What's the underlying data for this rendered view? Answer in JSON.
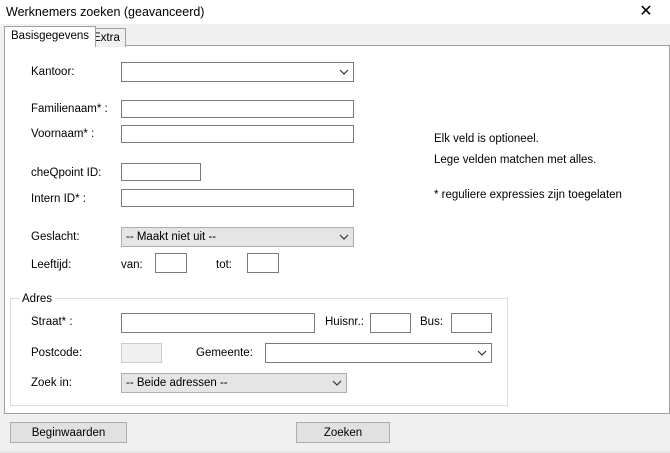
{
  "window": {
    "title": "Werknemers zoeken (geavanceerd)",
    "close_glyph": "✕"
  },
  "tabs": [
    {
      "label": "Basisgegevens",
      "active": true
    },
    {
      "label": "Extra",
      "active": false
    }
  ],
  "form": {
    "kantoor_label": "Kantoor:",
    "kantoor_value": "",
    "familienaam_label": "Familienaam* :",
    "familienaam_value": "",
    "voornaam_label": "Voornaam* :",
    "voornaam_value": "",
    "checkpoint_label": "cheQpoint ID:",
    "checkpoint_value": "",
    "intern_label": "Intern ID* :",
    "intern_value": "",
    "geslacht_label": "Geslacht:",
    "geslacht_value": "-- Maakt niet uit --",
    "leeftijd_label": "Leeftijd:",
    "van_label": "van:",
    "van_value": "",
    "tot_label": "tot:",
    "tot_value": ""
  },
  "notes": {
    "line1": "Elk veld is optioneel.",
    "line2": "Lege velden matchen met alles.",
    "line3": "* reguliere expressies zijn toegelaten"
  },
  "adres": {
    "group_label": "Adres",
    "straat_label": "Straat* :",
    "straat_value": "",
    "huisnr_label": "Huisnr.:",
    "huisnr_value": "",
    "bus_label": "Bus:",
    "bus_value": "",
    "postcode_label": "Postcode:",
    "postcode_value": "",
    "gemeente_label": "Gemeente:",
    "gemeente_value": "",
    "zoekin_label": "Zoek in:",
    "zoekin_value": "-- Beide adressen --"
  },
  "buttons": {
    "reset_label": "Beginwaarden",
    "search_label": "Zoeken"
  }
}
